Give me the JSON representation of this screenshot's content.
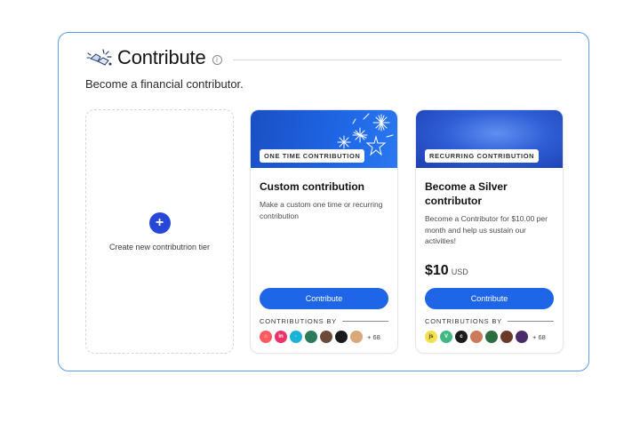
{
  "section": {
    "title": "Contribute",
    "subtitle": "Become a financial contributor.",
    "info_icon": "info-icon",
    "header_icon": "celebration-hands-icon"
  },
  "new_tier": {
    "label": "Create new contributrion tier",
    "icon": "plus-icon"
  },
  "tiers": [
    {
      "tag": "ONE TIME CONTRIBUTION",
      "title": "Custom contribution",
      "description": "Make a custom one time or recurring contribution",
      "button": "Contribute",
      "contributions_by": "CONTRIBUTIONS BY",
      "more_count": "+ 68",
      "avatar_colors": [
        "#ff5a5f",
        "#e8336d",
        "#1ab2d8",
        "#2c7a59",
        "#6b4a3a",
        "#1a1a1a",
        "#d8a878"
      ]
    },
    {
      "tag": "RECURRING CONTRIBUTION",
      "title": "Become a Silver contributor",
      "description": "Become a Contributor for $10.00 per month and help us sustain our activities!",
      "price": "$10",
      "currency": "USD",
      "button": "Contribute",
      "contributions_by": "CONTRIBUTIONS BY",
      "more_count": "+ 68",
      "avatar_colors": [
        "#f4e04d",
        "#41b883",
        "#1a1a1a",
        "#c97b5a",
        "#2b6e3f",
        "#6b3b2a",
        "#4a2a6a"
      ]
    }
  ],
  "colors": {
    "accent": "#1f65e8",
    "plus": "#2947d6",
    "panel_border": "#5b9bf0"
  }
}
